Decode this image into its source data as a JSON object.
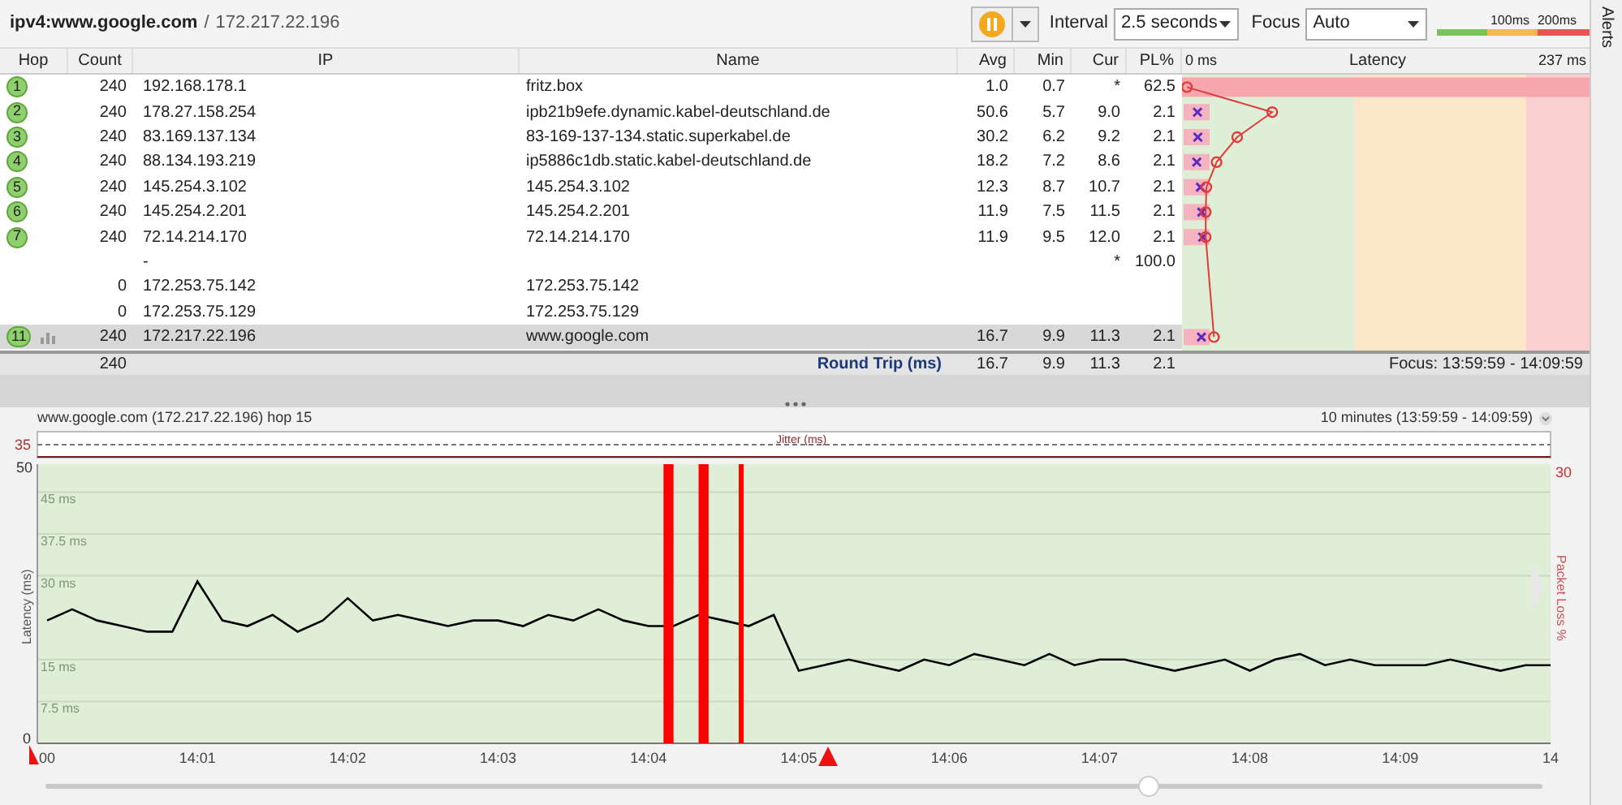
{
  "header": {
    "target": "ipv4:www.google.com",
    "separator": "/",
    "ip": "172.217.22.196"
  },
  "toolbar": {
    "interval": {
      "label": "Interval",
      "value": "2.5 seconds"
    },
    "focus": {
      "label": "Focus",
      "value": "Auto"
    },
    "legend": [
      "100ms",
      "200ms"
    ]
  },
  "alerts_tab": "Alerts",
  "table": {
    "columns": [
      "Hop",
      "Count",
      "IP",
      "Name",
      "Avg",
      "Min",
      "Cur",
      "PL%"
    ],
    "latency_header": {
      "min": "0 ms",
      "title": "Latency",
      "max": "237 ms"
    },
    "rows": [
      {
        "hop": "1",
        "count": "240",
        "ip": "192.168.178.1",
        "name": "fritz.box",
        "avg": "1.0",
        "min": "0.7",
        "cur": "*",
        "pl": "62.5",
        "has_graph": false,
        "selected": false
      },
      {
        "hop": "2",
        "count": "240",
        "ip": "178.27.158.254",
        "name": "ipb21b9efe.dynamic.kabel-deutschland.de",
        "avg": "50.6",
        "min": "5.7",
        "cur": "9.0",
        "pl": "2.1",
        "has_graph": false,
        "selected": false
      },
      {
        "hop": "3",
        "count": "240",
        "ip": "83.169.137.134",
        "name": "83-169-137-134.static.superkabel.de",
        "avg": "30.2",
        "min": "6.2",
        "cur": "9.2",
        "pl": "2.1",
        "has_graph": false,
        "selected": false
      },
      {
        "hop": "4",
        "count": "240",
        "ip": "88.134.193.219",
        "name": "ip5886c1db.static.kabel-deutschland.de",
        "avg": "18.2",
        "min": "7.2",
        "cur": "8.6",
        "pl": "2.1",
        "has_graph": false,
        "selected": false
      },
      {
        "hop": "5",
        "count": "240",
        "ip": "145.254.3.102",
        "name": "145.254.3.102",
        "avg": "12.3",
        "min": "8.7",
        "cur": "10.7",
        "pl": "2.1",
        "has_graph": false,
        "selected": false
      },
      {
        "hop": "6",
        "count": "240",
        "ip": "145.254.2.201",
        "name": "145.254.2.201",
        "avg": "11.9",
        "min": "7.5",
        "cur": "11.5",
        "pl": "2.1",
        "has_graph": false,
        "selected": false
      },
      {
        "hop": "7",
        "count": "240",
        "ip": "72.14.214.170",
        "name": "72.14.214.170",
        "avg": "11.9",
        "min": "9.5",
        "cur": "12.0",
        "pl": "2.1",
        "has_graph": false,
        "selected": false
      },
      {
        "ip": "-",
        "cur": "*",
        "pl": "100.0",
        "has_graph": false,
        "selected": false
      },
      {
        "count": "0",
        "ip": "172.253.75.142",
        "name": "172.253.75.142",
        "has_graph": false,
        "selected": false
      },
      {
        "count": "0",
        "ip": "172.253.75.129",
        "name": "172.253.75.129",
        "has_graph": false,
        "selected": false
      },
      {
        "hop": "11",
        "count": "240",
        "ip": "172.217.22.196",
        "name": "www.google.com",
        "avg": "16.7",
        "min": "9.9",
        "cur": "11.3",
        "pl": "2.1",
        "has_graph": true,
        "selected": true
      }
    ],
    "summary": {
      "count": "240",
      "label": "Round Trip (ms)",
      "avg": "16.7",
      "min": "9.9",
      "cur": "11.3",
      "pl": "2.1",
      "focus": "Focus: 13:59:59 - 14:09:59"
    }
  },
  "graph": {
    "title": "www.google.com (172.217.22.196) hop 15",
    "range": "10 minutes (13:59:59 - 14:09:59)",
    "jitter_label": "Jitter (ms)",
    "jitter_max": "35",
    "loss_max": "30",
    "grid_labels": [
      "45 ms",
      "37.5 ms",
      "30 ms",
      "15 ms",
      "7.5 ms"
    ],
    "chart_data": {
      "type": "line",
      "ylim": [
        0,
        50
      ],
      "yticks": [
        0,
        50
      ],
      "categories": [
        "00",
        null,
        null,
        null,
        null,
        null,
        "14:01",
        null,
        null,
        null,
        null,
        null,
        "14:02",
        null,
        null,
        null,
        null,
        null,
        "14:03",
        null,
        null,
        null,
        null,
        null,
        "14:04",
        null,
        null,
        null,
        null,
        null,
        "14:05",
        null,
        null,
        null,
        null,
        null,
        "14:06",
        null,
        null,
        null,
        null,
        null,
        "14:07",
        null,
        null,
        null,
        null,
        null,
        "14:08",
        null,
        null,
        null,
        null,
        null,
        "14:09",
        null,
        null,
        null,
        null,
        null,
        "14"
      ],
      "series": [
        {
          "name": "Latency (ms)",
          "color": "#000000",
          "values": [
            22,
            24,
            22,
            21,
            20,
            20,
            29,
            22,
            21,
            23,
            20,
            22,
            26,
            22,
            23,
            22,
            21,
            22,
            22,
            21,
            23,
            22,
            24,
            22,
            21,
            21,
            23,
            22,
            21,
            23,
            13,
            14,
            15,
            14,
            13,
            15,
            14,
            16,
            15,
            14,
            16,
            14,
            15,
            15,
            14,
            13,
            14,
            15,
            13,
            15,
            16,
            14,
            15,
            14,
            14,
            14,
            15,
            14,
            13,
            14,
            14
          ]
        }
      ]
    },
    "ylabel_right": "Packet Loss %"
  },
  "timeline_slider": {
    "level": 0.74
  }
}
